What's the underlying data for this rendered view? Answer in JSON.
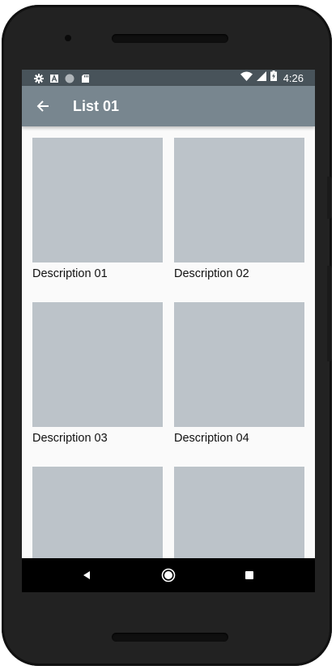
{
  "status_bar": {
    "time": "4:26",
    "left_icons": [
      "gear-icon",
      "font-a-icon",
      "circle-icon",
      "sd-card-icon"
    ],
    "right_icons": [
      "wifi-icon",
      "signal-icon",
      "battery-charging-icon"
    ]
  },
  "app_bar": {
    "title": "List 01",
    "back_icon": "arrow-back-icon"
  },
  "grid": {
    "items": [
      {
        "description": "Description 01"
      },
      {
        "description": "Description 02"
      },
      {
        "description": "Description 03"
      },
      {
        "description": "Description 04"
      },
      {
        "description": ""
      },
      {
        "description": ""
      }
    ]
  },
  "nav_bar": {
    "buttons": [
      "nav-back-icon",
      "nav-home-icon",
      "nav-recent-icon"
    ]
  },
  "colors": {
    "status_bar": "#48535a",
    "app_bar": "#78868f",
    "thumb": "#bcc3c9",
    "background": "#fafafa"
  }
}
